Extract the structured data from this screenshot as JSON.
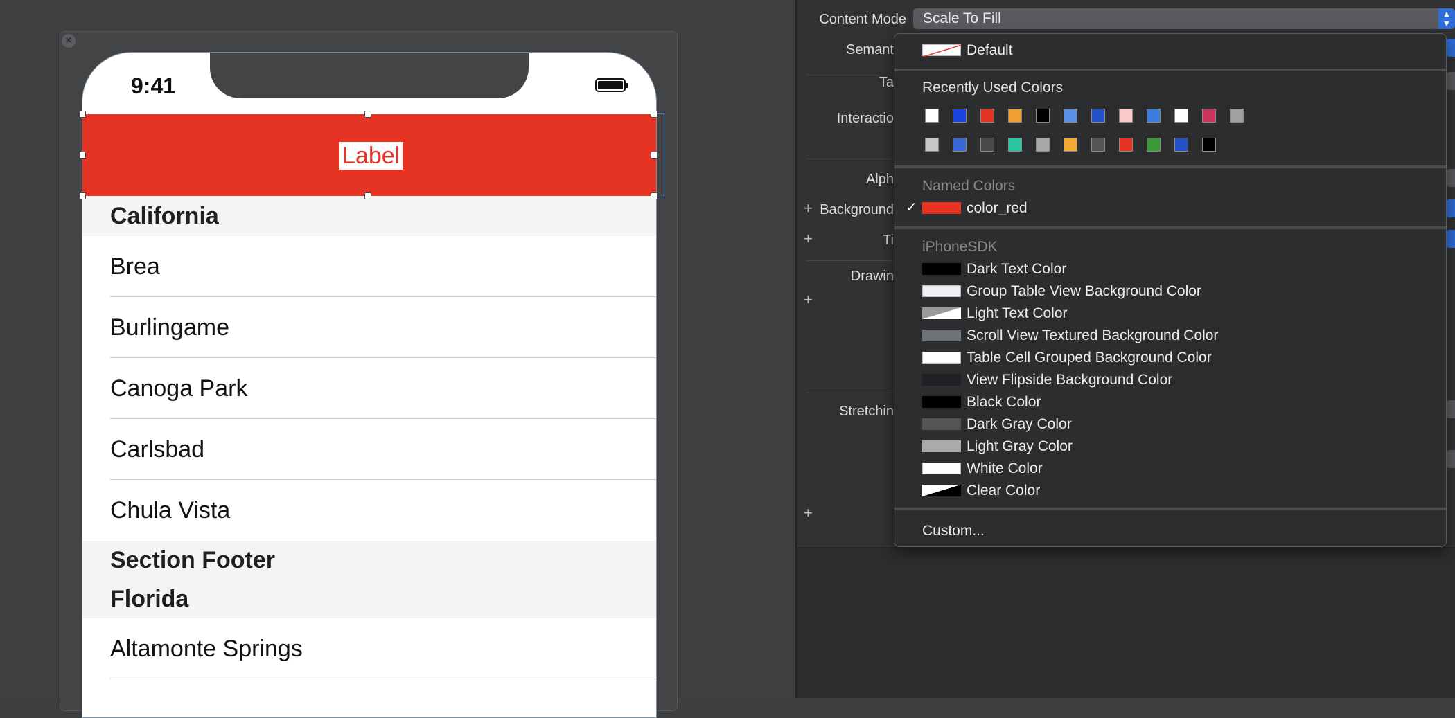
{
  "canvas": {
    "status_time": "9:41",
    "label_text": "Label",
    "sections": [
      {
        "header": "California",
        "rows": [
          "Brea",
          "Burlingame",
          "Canoga Park",
          "Carlsbad",
          "Chula Vista"
        ]
      },
      {
        "footer": "Section Footer",
        "header": "Florida",
        "rows": [
          "Altamonte Springs"
        ]
      }
    ]
  },
  "inspector": {
    "content_mode_label": "Content Mode",
    "content_mode_value": "Scale To Fill",
    "labels": {
      "semantic": "Semant",
      "tag": "Ta",
      "interaction": "Interactio",
      "alpha": "Alph",
      "background": "Background",
      "tint": "Ti",
      "drawing": "Drawin",
      "stretching": "Stretchin"
    }
  },
  "color_menu": {
    "default_label": "Default",
    "recently_used_title": "Recently Used Colors",
    "recent_row1": [
      "#ffffff",
      "#1b44e0",
      "#e53423",
      "#f0a030",
      "#000000",
      "#5a8fe6",
      "#2450c8",
      "#f9c9cc",
      "#3d7de0",
      "#ffffff",
      "#c9355a",
      "#a0a0a0"
    ],
    "recent_row2": [
      "#c8c8c8",
      "#3a66d8",
      "#4a4a4a",
      "#2cc6a4",
      "#a8a8a8",
      "#f5a733",
      "#555555",
      "#e53423",
      "#3a9a3a",
      "#2450c8",
      "#000000"
    ],
    "named_colors_title": "Named Colors",
    "named_colors": [
      {
        "name": "color_red",
        "swatch": "#e53423",
        "selected": true
      }
    ],
    "iphone_sdk_title": "iPhoneSDK",
    "sdk_colors": [
      {
        "name": "Dark Text Color",
        "swatch": "#000000"
      },
      {
        "name": "Group Table View Background Color",
        "swatch": "#efeff4"
      },
      {
        "name": "Light Text Color",
        "swatch": "light-diagonal"
      },
      {
        "name": "Scroll View Textured Background Color",
        "swatch": "#6f7178"
      },
      {
        "name": "Table Cell Grouped Background Color",
        "swatch": "#ffffff"
      },
      {
        "name": "View Flipside Background Color",
        "swatch": "#1f2124"
      },
      {
        "name": "Black Color",
        "swatch": "#000000"
      },
      {
        "name": "Dark Gray Color",
        "swatch": "#555555"
      },
      {
        "name": "Light Gray Color",
        "swatch": "#aaaaaa"
      },
      {
        "name": "White Color",
        "swatch": "#ffffff"
      },
      {
        "name": "Clear Color",
        "swatch": "clear-diagonal"
      }
    ],
    "custom_label": "Custom..."
  }
}
